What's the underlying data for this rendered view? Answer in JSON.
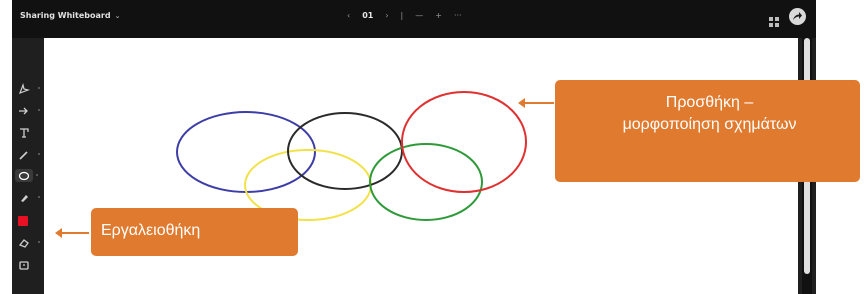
{
  "app": {
    "title": "Sharing Whiteboard",
    "title_chevron": "⌄",
    "pager": {
      "prev": "‹",
      "page": "01",
      "next": "›",
      "divider": "|",
      "zoom_out": "—",
      "zoom_in": "+",
      "more": "···"
    }
  },
  "toolbar": {
    "tools": [
      {
        "name": "select-tool",
        "icon": "pointer-icon"
      },
      {
        "name": "arrow-tool",
        "icon": "arrow-icon"
      },
      {
        "name": "text-tool",
        "icon": "text-icon"
      },
      {
        "name": "pen-tool",
        "icon": "pen-icon"
      },
      {
        "name": "shape-tool",
        "icon": "ellipse-icon",
        "active": true
      },
      {
        "name": "highlighter-tool",
        "icon": "highlighter-icon"
      },
      {
        "name": "color-tool",
        "icon": "color-swatch",
        "color": "#e81123"
      },
      {
        "name": "eraser-tool",
        "icon": "eraser-icon"
      },
      {
        "name": "frame-tool",
        "icon": "frame-icon"
      }
    ]
  },
  "canvas": {
    "shapes": [
      {
        "type": "ellipse",
        "color": "#3d3da8"
      },
      {
        "type": "ellipse",
        "color": "#2a2a2a"
      },
      {
        "type": "ellipse",
        "color": "#e03030"
      },
      {
        "type": "ellipse",
        "color": "#f2e24a"
      },
      {
        "type": "ellipse",
        "color": "#2e9a3a"
      }
    ]
  },
  "annotations": {
    "shapes_callout_line1": "Προσθήκη –",
    "shapes_callout_line2": "μορφοποίηση σχημάτων",
    "toolbox_callout": "Εργαλειοθήκη",
    "accent_color": "#e07a2f"
  }
}
